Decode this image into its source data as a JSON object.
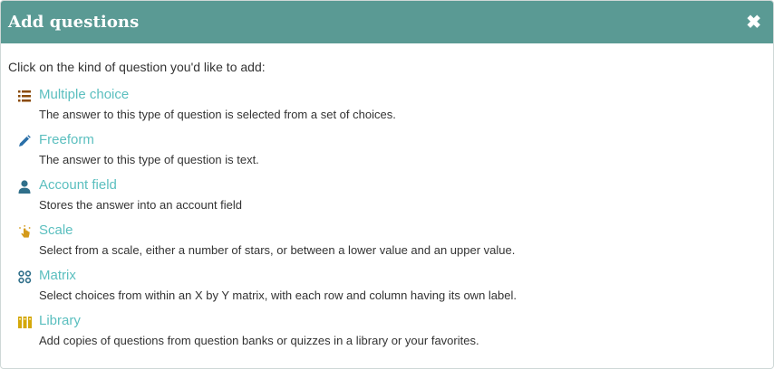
{
  "dialog": {
    "title": "Add questions",
    "close_glyph": "✖"
  },
  "intro": "Click on the kind of question you'd like to add:",
  "questions": [
    {
      "title": "Multiple choice",
      "description": "The answer to this type of question is selected from a set of choices.",
      "icon": "list-icon",
      "icon_color": "#8a4b08"
    },
    {
      "title": "Freeform",
      "description": "The answer to this type of question is text.",
      "icon": "pencil-icon",
      "icon_color": "#2a6fa8"
    },
    {
      "title": "Account field",
      "description": "Stores the answer into an account field",
      "icon": "user-icon",
      "icon_color": "#2f6f8a"
    },
    {
      "title": "Scale",
      "description": "Select from a scale, either a number of stars, or between a lower value and an upper value.",
      "icon": "scale-icon",
      "icon_color": "#d49a1a"
    },
    {
      "title": "Matrix",
      "description": "Select choices from within an X by Y matrix, with each row and column having its own label.",
      "icon": "matrix-icon",
      "icon_color": "#2f6f8a"
    },
    {
      "title": "Library",
      "description": "Add copies of questions from question banks or quizzes in a library or your favorites.",
      "icon": "library-icon",
      "icon_color": "#d4a80a"
    }
  ],
  "colors": {
    "header_bg": "#5a9a94",
    "link": "#5bbfbf",
    "text": "#333333"
  }
}
